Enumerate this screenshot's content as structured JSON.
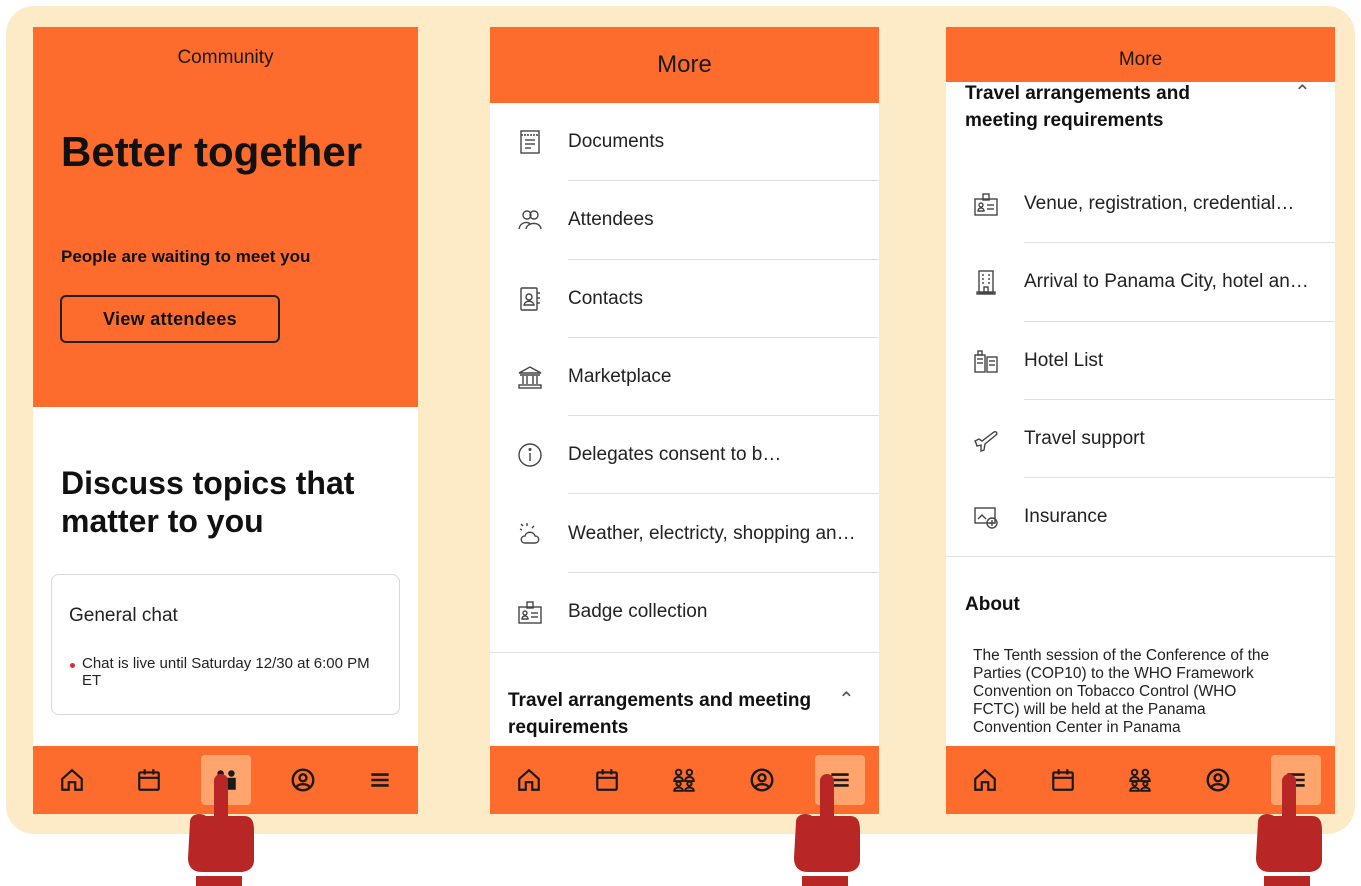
{
  "colors": {
    "accent": "#fd6c2d",
    "active_nav": "#ffa46d",
    "frame": "#fdebc8",
    "hand": "#b82626"
  },
  "screen1": {
    "header": "Community",
    "hero_title": "Better together",
    "hero_subtitle": "People are waiting to meet you",
    "view_button": "View attendees",
    "section_title": "Discuss topics that matter to you",
    "chat": {
      "title": "General chat",
      "status": "Chat is live until Saturday 12/30 at 6:00 PM ET"
    },
    "active_nav": "community"
  },
  "screen2": {
    "header": "More",
    "items": [
      {
        "label": "Documents",
        "icon": "document-icon"
      },
      {
        "label": "Attendees",
        "icon": "attendees-icon"
      },
      {
        "label": "Contacts",
        "icon": "contacts-icon"
      },
      {
        "label": "Marketplace",
        "icon": "marketplace-icon"
      },
      {
        "label": "Delegates consent to b…",
        "icon": "info-icon"
      },
      {
        "label": "Weather, electricty, shopping an…",
        "icon": "weather-icon"
      },
      {
        "label": "Badge collection",
        "icon": "badge-icon"
      }
    ],
    "section_title": "Travel arrangements and meeting requirements",
    "active_nav": "more"
  },
  "screen3": {
    "header": "More",
    "section_title": "Travel arrangements and meeting requirements",
    "items": [
      {
        "label": "Venue, registration, credential…",
        "icon": "badge-icon"
      },
      {
        "label": "Arrival to Panama City, hotel an…",
        "icon": "building-icon"
      },
      {
        "label": "Hotel List",
        "icon": "hotel-icon"
      },
      {
        "label": "Travel support",
        "icon": "airplane-icon"
      },
      {
        "label": "Insurance",
        "icon": "insurance-icon"
      }
    ],
    "about_title": "About",
    "about_text": "The Tenth session of the Conference of the Parties (COP10) to the WHO Framework Convention on Tobacco Control (WHO FCTC) will be held at the Panama Convention Center in Panama",
    "active_nav": "more"
  },
  "nav_items": [
    "home",
    "schedule",
    "community",
    "profile",
    "more"
  ]
}
